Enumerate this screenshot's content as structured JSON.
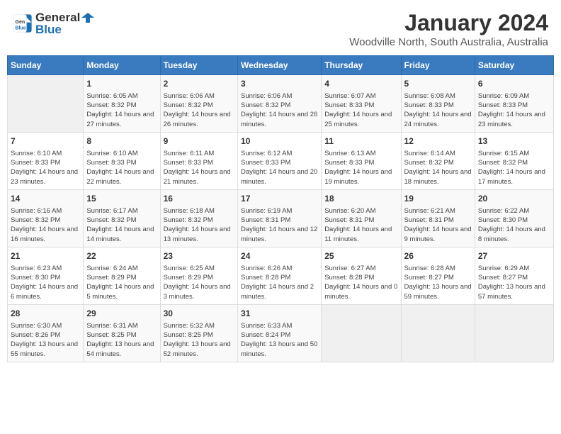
{
  "header": {
    "logo_line1": "General",
    "logo_line2": "Blue",
    "month": "January 2024",
    "location": "Woodville North, South Australia, Australia"
  },
  "weekdays": [
    "Sunday",
    "Monday",
    "Tuesday",
    "Wednesday",
    "Thursday",
    "Friday",
    "Saturday"
  ],
  "weeks": [
    [
      {
        "day": "",
        "empty": true
      },
      {
        "day": "1",
        "sunrise": "6:05 AM",
        "sunset": "8:32 PM",
        "daylight": "14 hours and 27 minutes."
      },
      {
        "day": "2",
        "sunrise": "6:06 AM",
        "sunset": "8:32 PM",
        "daylight": "14 hours and 26 minutes."
      },
      {
        "day": "3",
        "sunrise": "6:06 AM",
        "sunset": "8:32 PM",
        "daylight": "14 hours and 26 minutes."
      },
      {
        "day": "4",
        "sunrise": "6:07 AM",
        "sunset": "8:33 PM",
        "daylight": "14 hours and 25 minutes."
      },
      {
        "day": "5",
        "sunrise": "6:08 AM",
        "sunset": "8:33 PM",
        "daylight": "14 hours and 24 minutes."
      },
      {
        "day": "6",
        "sunrise": "6:09 AM",
        "sunset": "8:33 PM",
        "daylight": "14 hours and 23 minutes."
      }
    ],
    [
      {
        "day": "7",
        "sunrise": "6:10 AM",
        "sunset": "8:33 PM",
        "daylight": "14 hours and 23 minutes."
      },
      {
        "day": "8",
        "sunrise": "6:10 AM",
        "sunset": "8:33 PM",
        "daylight": "14 hours and 22 minutes."
      },
      {
        "day": "9",
        "sunrise": "6:11 AM",
        "sunset": "8:33 PM",
        "daylight": "14 hours and 21 minutes."
      },
      {
        "day": "10",
        "sunrise": "6:12 AM",
        "sunset": "8:33 PM",
        "daylight": "14 hours and 20 minutes."
      },
      {
        "day": "11",
        "sunrise": "6:13 AM",
        "sunset": "8:33 PM",
        "daylight": "14 hours and 19 minutes."
      },
      {
        "day": "12",
        "sunrise": "6:14 AM",
        "sunset": "8:32 PM",
        "daylight": "14 hours and 18 minutes."
      },
      {
        "day": "13",
        "sunrise": "6:15 AM",
        "sunset": "8:32 PM",
        "daylight": "14 hours and 17 minutes."
      }
    ],
    [
      {
        "day": "14",
        "sunrise": "6:16 AM",
        "sunset": "8:32 PM",
        "daylight": "14 hours and 16 minutes."
      },
      {
        "day": "15",
        "sunrise": "6:17 AM",
        "sunset": "8:32 PM",
        "daylight": "14 hours and 14 minutes."
      },
      {
        "day": "16",
        "sunrise": "6:18 AM",
        "sunset": "8:32 PM",
        "daylight": "14 hours and 13 minutes."
      },
      {
        "day": "17",
        "sunrise": "6:19 AM",
        "sunset": "8:31 PM",
        "daylight": "14 hours and 12 minutes."
      },
      {
        "day": "18",
        "sunrise": "6:20 AM",
        "sunset": "8:31 PM",
        "daylight": "14 hours and 11 minutes."
      },
      {
        "day": "19",
        "sunrise": "6:21 AM",
        "sunset": "8:31 PM",
        "daylight": "14 hours and 9 minutes."
      },
      {
        "day": "20",
        "sunrise": "6:22 AM",
        "sunset": "8:30 PM",
        "daylight": "14 hours and 8 minutes."
      }
    ],
    [
      {
        "day": "21",
        "sunrise": "6:23 AM",
        "sunset": "8:30 PM",
        "daylight": "14 hours and 6 minutes."
      },
      {
        "day": "22",
        "sunrise": "6:24 AM",
        "sunset": "8:29 PM",
        "daylight": "14 hours and 5 minutes."
      },
      {
        "day": "23",
        "sunrise": "6:25 AM",
        "sunset": "8:29 PM",
        "daylight": "14 hours and 3 minutes."
      },
      {
        "day": "24",
        "sunrise": "6:26 AM",
        "sunset": "8:28 PM",
        "daylight": "14 hours and 2 minutes."
      },
      {
        "day": "25",
        "sunrise": "6:27 AM",
        "sunset": "8:28 PM",
        "daylight": "14 hours and 0 minutes."
      },
      {
        "day": "26",
        "sunrise": "6:28 AM",
        "sunset": "8:27 PM",
        "daylight": "13 hours and 59 minutes."
      },
      {
        "day": "27",
        "sunrise": "6:29 AM",
        "sunset": "8:27 PM",
        "daylight": "13 hours and 57 minutes."
      }
    ],
    [
      {
        "day": "28",
        "sunrise": "6:30 AM",
        "sunset": "8:26 PM",
        "daylight": "13 hours and 55 minutes."
      },
      {
        "day": "29",
        "sunrise": "6:31 AM",
        "sunset": "8:25 PM",
        "daylight": "13 hours and 54 minutes."
      },
      {
        "day": "30",
        "sunrise": "6:32 AM",
        "sunset": "8:25 PM",
        "daylight": "13 hours and 52 minutes."
      },
      {
        "day": "31",
        "sunrise": "6:33 AM",
        "sunset": "8:24 PM",
        "daylight": "13 hours and 50 minutes."
      },
      {
        "day": "",
        "empty": true
      },
      {
        "day": "",
        "empty": true
      },
      {
        "day": "",
        "empty": true
      }
    ]
  ]
}
